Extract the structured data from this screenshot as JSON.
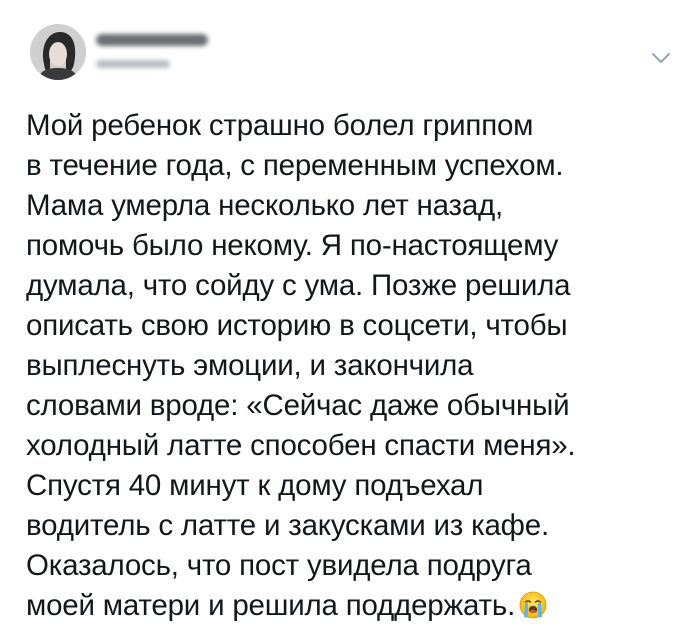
{
  "tweet": {
    "avatar_icon": "avatar-photo",
    "menu_icon": "chevron-down-icon",
    "text_lines": [
      "Мой ребенок страшно болел гриппом",
      "в течение года, с переменным успехом.",
      "Мама умерла несколько лет назад,",
      "помочь было некому. Я по-настоящему",
      "думала, что сойду с ума. Позже решила",
      "описать свою историю в соцсети, чтобы",
      "выплеснуть эмоции, и закончила",
      "словами вроде: «Сейчас даже обычный",
      "холодный латте способен спасти меня».",
      "Спустя 40 минут к дому подъехал",
      "водитель с латте и закусками из кафе.",
      "Оказалось, что пост увидела подруга",
      "моей матери и решила поддержать."
    ],
    "emoji": "loudly-crying-face-emoji",
    "colors": {
      "text": "#14171a",
      "chevron": "#8899a6",
      "background": "#ffffff"
    }
  }
}
